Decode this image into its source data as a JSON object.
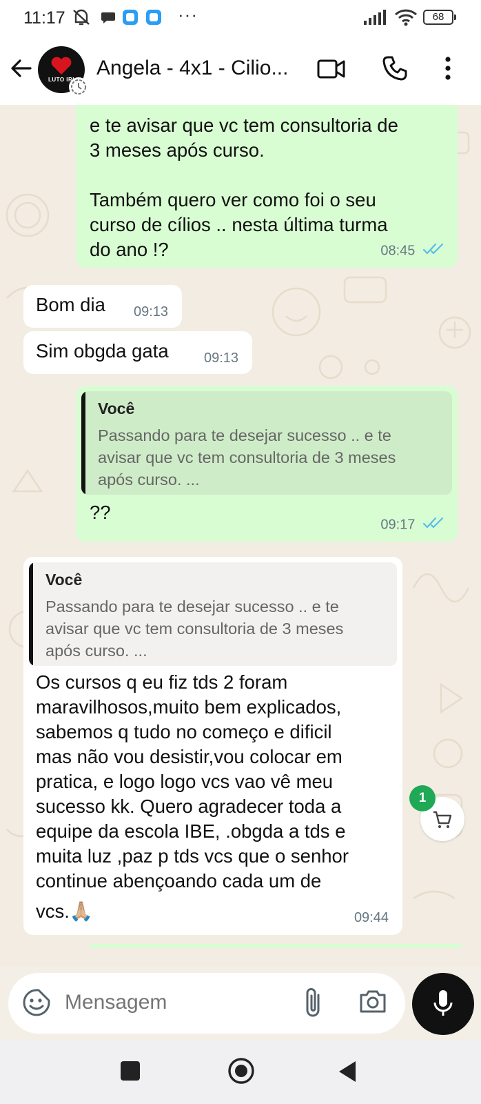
{
  "status_bar": {
    "time": "11:17",
    "battery": "68",
    "overflow_dots": "···"
  },
  "header": {
    "title": "Angela - 4x1 - Cilio...",
    "avatar_text": "LUTO IRI"
  },
  "messages": [
    {
      "direction": "outgoing",
      "text_lines": [
        "e te avisar que vc tem consultoria de",
        "3 meses após curso.",
        "",
        "Também quero ver como foi o seu",
        "curso de cílios .. nesta última turma",
        "do ano !?"
      ],
      "time": "08:45",
      "status": "read"
    },
    {
      "direction": "incoming",
      "text": "Bom dia",
      "time": "09:13"
    },
    {
      "direction": "incoming",
      "text": "Sim obgda gata",
      "time": "09:13"
    },
    {
      "direction": "outgoing",
      "quote_author": "Você",
      "quote_lines": [
        "Passando para te desejar sucesso .. e te",
        "avisar que vc tem consultoria de 3 meses",
        "após curso. ..."
      ],
      "text": "??",
      "time": "09:17",
      "status": "read"
    },
    {
      "direction": "incoming",
      "quote_author": "Você",
      "quote_lines": [
        "Passando para te desejar sucesso .. e te",
        "avisar que vc tem consultoria de 3 meses",
        "após curso. ..."
      ],
      "text_lines": [
        "Os cursos q eu fiz tds 2 foram",
        "maravilhosos,muito bem explicados,",
        "sabemos q tudo no começo e dificil",
        "mas não vou desistir,vou colocar em",
        "pratica, e logo logo vcs vao vê meu",
        "sucesso kk. Quero agradecer toda a",
        "equipe da escola IBE, .obgda a tds e",
        "muita luz ,paz p tds vcs que o senhor",
        "continue abençoando cada um de",
        "vcs.🙏🏼"
      ],
      "time": "09:44"
    }
  ],
  "cart": {
    "badge_count": "1"
  },
  "composer": {
    "placeholder": "Mensagem"
  },
  "colors": {
    "outgoing_bubble": "#d9fdd3",
    "incoming_bubble": "#ffffff",
    "read_ticks": "#53bdeb",
    "badge": "#1fa855",
    "mic_button": "#111111"
  },
  "icons": [
    "back-arrow-icon",
    "video-call-icon",
    "phone-icon",
    "more-vert-icon",
    "emoji-sticker-icon",
    "attach-paperclip-icon",
    "camera-icon",
    "mic-icon",
    "shopping-cart-icon",
    "read-ticks-icon",
    "nav-recents-icon",
    "nav-home-icon",
    "nav-back-icon"
  ]
}
